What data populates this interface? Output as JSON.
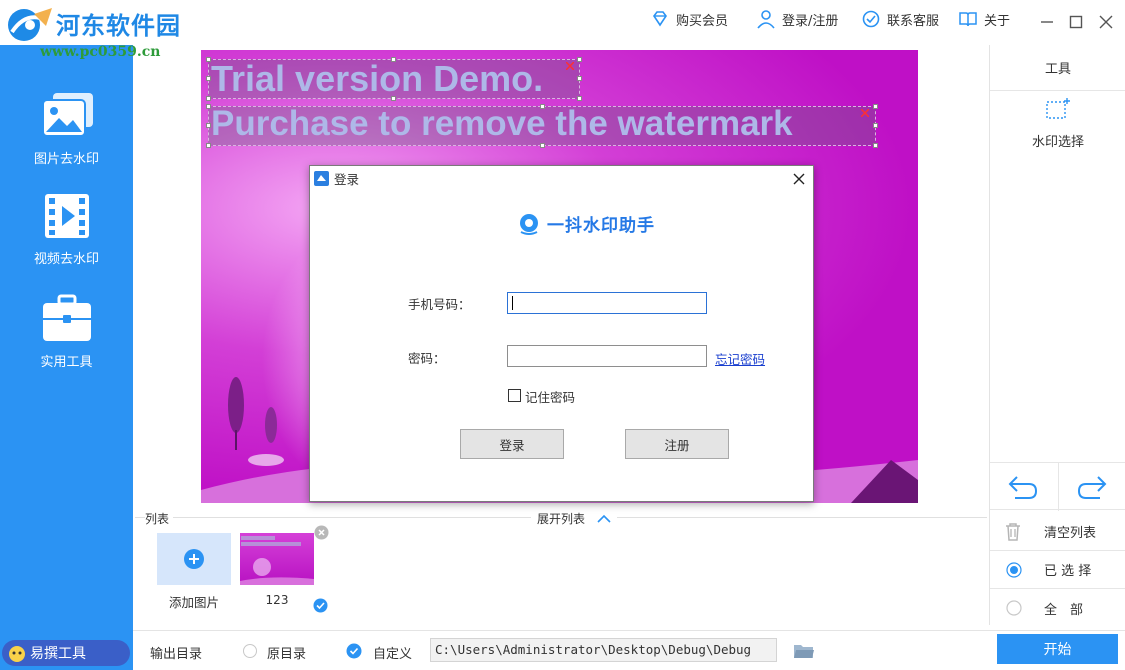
{
  "app": {
    "logo_text": "河东软件园",
    "logo_url": "www.pc0359.cn"
  },
  "topnav": {
    "vip": "购买会员",
    "login": "登录/注册",
    "support": "联系客服",
    "about": "关于"
  },
  "sidebar": {
    "items": [
      {
        "label": "图片去水印",
        "icon": "image-icon"
      },
      {
        "label": "视频去水印",
        "icon": "video-icon"
      },
      {
        "label": "实用工具",
        "icon": "toolbox-icon"
      }
    ],
    "bottom_badge": "易撰工具"
  },
  "canvas": {
    "watermark_line1": "Trial version Demo.",
    "watermark_line2": "Purchase to remove the watermark"
  },
  "tools": {
    "title": "工具",
    "watermark_select": "水印选择",
    "clear_list": "清空列表",
    "selected": "已 选 择",
    "all": "全　部"
  },
  "list": {
    "title": "列表",
    "expand": "展开列表",
    "add_image": "添加图片",
    "items": [
      {
        "name": "123",
        "checked": true
      }
    ]
  },
  "bottombar": {
    "output_dir_label": "输出目录",
    "original_dir": "原目录",
    "custom": "自定义",
    "custom_selected": true,
    "path": "C:\\Users\\Administrator\\Desktop\\Debug\\Debug",
    "start": "开始"
  },
  "dialog": {
    "title": "登录",
    "brand": "一抖水印助手",
    "phone_label": "手机号码：",
    "phone_value": "",
    "password_label": "密码：",
    "password_value": "",
    "forgot": "忘记密码",
    "remember": "记住密码",
    "remember_checked": false,
    "login_button": "登录",
    "register_button": "注册"
  },
  "colors": {
    "accent": "#2b93f3",
    "sidebar": "#2b93f3",
    "brand_blue": "#2579e6",
    "link": "#1a3fcf",
    "magenta": "#c21ecb"
  }
}
